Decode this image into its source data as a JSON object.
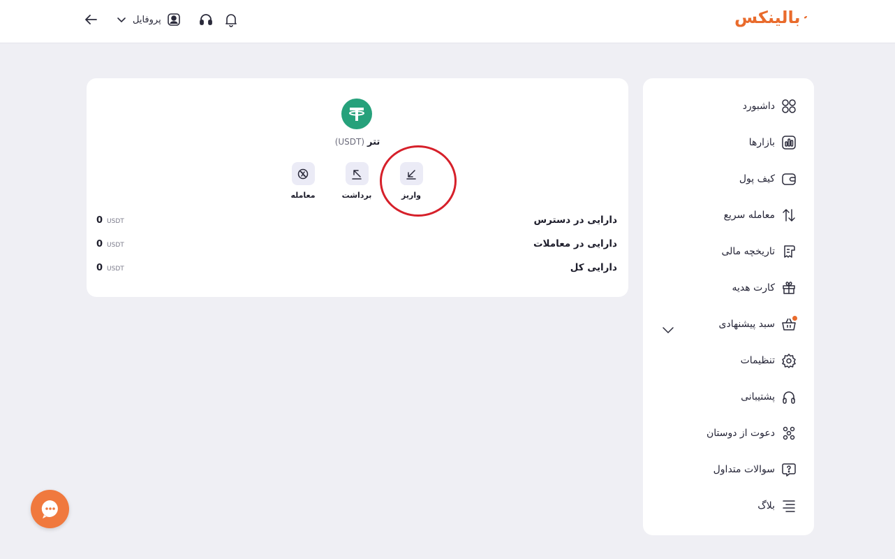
{
  "header": {
    "logo_text": "بالینکس",
    "profile_label": "پروفایل"
  },
  "sidebar": {
    "items": [
      {
        "label": "داشبورد",
        "icon": "dashboard-icon"
      },
      {
        "label": "بازارها",
        "icon": "markets-icon"
      },
      {
        "label": "کیف پول",
        "icon": "wallet-icon"
      },
      {
        "label": "معامله سریع",
        "icon": "swap-arrows-icon"
      },
      {
        "label": "تاریخچه مالی",
        "icon": "receipt-icon"
      },
      {
        "label": "کارت هدیه",
        "icon": "gift-icon"
      },
      {
        "label": "سبد پیشنهادی",
        "icon": "basket-icon"
      },
      {
        "label": "تنظیمات",
        "icon": "gear-icon"
      },
      {
        "label": "پشتیبانی",
        "icon": "headset-icon"
      },
      {
        "label": "دعوت از دوستان",
        "icon": "users-icon"
      },
      {
        "label": "سوالات متداول",
        "icon": "faq-icon"
      },
      {
        "label": "بلاگ",
        "icon": "blog-icon"
      }
    ]
  },
  "asset": {
    "name": "تتر",
    "symbol": "(USDT)",
    "actions": {
      "deposit": "واریز",
      "withdraw": "برداشت",
      "trade": "معامله"
    },
    "balances": [
      {
        "title": "دارایی در دسترس",
        "value": "0",
        "unit": "USDT"
      },
      {
        "title": "دارایی در معاملات",
        "value": "0",
        "unit": "USDT"
      },
      {
        "title": "دارایی کل",
        "value": "0",
        "unit": "USDT"
      }
    ]
  },
  "colors": {
    "brand": "#e96b2c",
    "tether": "#26a17b",
    "highlight": "#d6202a"
  }
}
